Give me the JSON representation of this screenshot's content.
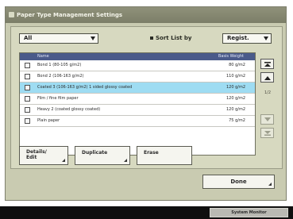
{
  "window": {
    "title": "Paper Type Management Settings"
  },
  "filter": {
    "selected": "All"
  },
  "sort": {
    "label": "Sort List by",
    "selected": "Regist."
  },
  "list": {
    "header_name": "Name",
    "header_size": "Basis Weight",
    "rows": [
      {
        "name": "Bond 1 (80-105 g/m2)",
        "size": "80 g/m2",
        "selected": false
      },
      {
        "name": "Bond 2 (106-163 g/m2)",
        "size": "110 g/m2",
        "selected": false
      },
      {
        "name": "Coated 3 (106-163 g/m2) 1 sided glossy coated",
        "size": "120 g/m2",
        "selected": true
      },
      {
        "name": "Film / fine film paper",
        "size": "120 g/m2",
        "selected": false
      },
      {
        "name": "Heavy 2 (coated glossy coated)",
        "size": "120 g/m2",
        "selected": false
      },
      {
        "name": "Plain paper",
        "size": "75 g/m2",
        "selected": false
      }
    ]
  },
  "scroll": {
    "page_indicator": "1/2"
  },
  "actions": {
    "details": "Details/\nEdit",
    "duplicate": "Duplicate",
    "erase": "Erase"
  },
  "done_label": "Done",
  "status": {
    "system_monitor": "System Monitor"
  },
  "colors": {
    "accent": "#9edcf2",
    "header": "#4a5a8a",
    "panel": "#c9cbb1"
  }
}
